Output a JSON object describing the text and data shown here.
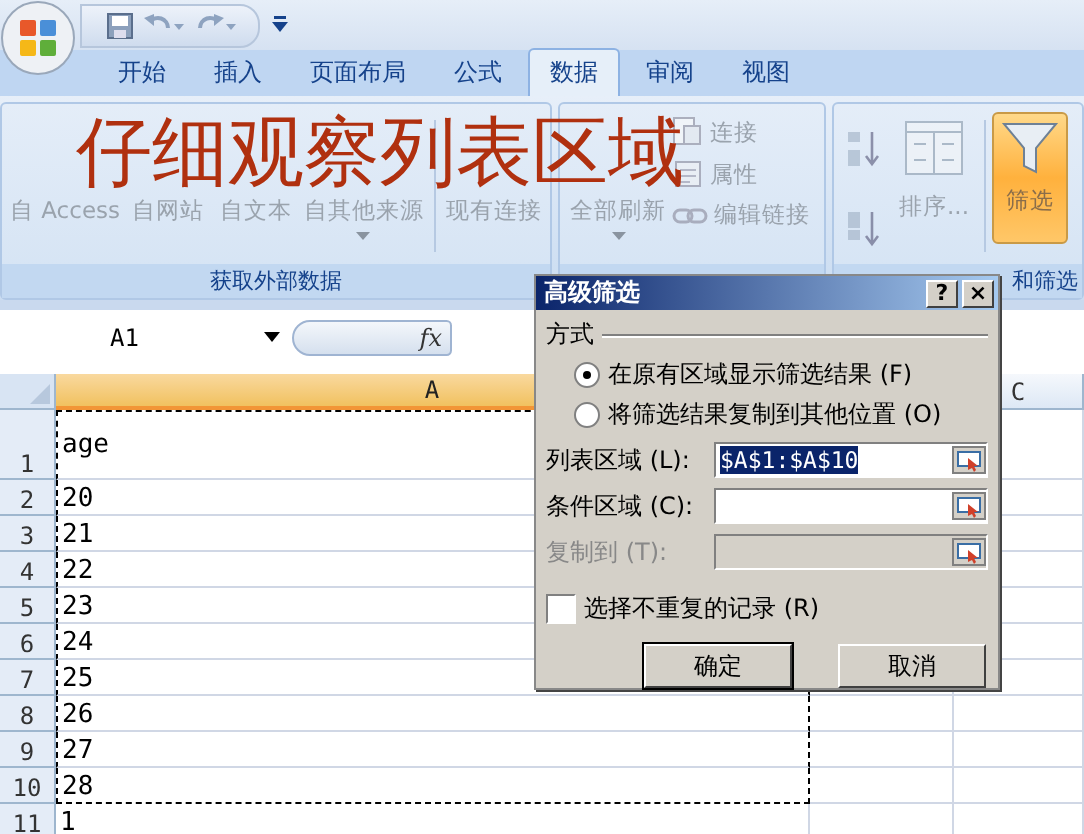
{
  "tabs": [
    {
      "label": "开始",
      "selected": false
    },
    {
      "label": "插入",
      "selected": false
    },
    {
      "label": "页面布局",
      "selected": false
    },
    {
      "label": "公式",
      "selected": false
    },
    {
      "label": "数据",
      "selected": true
    },
    {
      "label": "审阅",
      "selected": false
    },
    {
      "label": "视图",
      "selected": false
    }
  ],
  "ribbon": {
    "groups": [
      {
        "label": "获取外部数据",
        "buttons": [
          {
            "kind": "large",
            "label": "自 Access",
            "disabled": true,
            "pressed": false,
            "dropdown": false
          },
          {
            "kind": "large",
            "label": "自网站",
            "disabled": true,
            "pressed": false,
            "dropdown": false
          },
          {
            "kind": "large",
            "label": "自文本",
            "disabled": true,
            "pressed": false,
            "dropdown": false
          },
          {
            "kind": "large",
            "label": "自其他来源",
            "disabled": true,
            "pressed": false,
            "dropdown": true
          },
          {
            "kind": "large",
            "label": "现有连接",
            "disabled": true,
            "pressed": false,
            "dropdown": false
          }
        ]
      },
      {
        "buttons": [
          {
            "kind": "large",
            "label": "全部刷新",
            "disabled": true,
            "pressed": false,
            "dropdown": true
          },
          {
            "kind": "small",
            "label": "连接",
            "disabled": true,
            "pressed": false,
            "dropdown": false
          },
          {
            "kind": "small",
            "label": "属性",
            "disabled": true,
            "pressed": false,
            "dropdown": false
          },
          {
            "kind": "small",
            "label": "编辑链接",
            "disabled": true,
            "pressed": false,
            "dropdown": false
          }
        ]
      },
      {
        "label": "和筛选",
        "buttons": [
          {
            "kind": "sort",
            "disabled": true,
            "pressed": false,
            "dropdown": false
          },
          {
            "kind": "large",
            "label": "排序...",
            "disabled": true,
            "pressed": false,
            "dropdown": false
          },
          {
            "kind": "large",
            "label": "筛选",
            "disabled": true,
            "pressed": true,
            "dropdown": false
          }
        ]
      }
    ]
  },
  "annotation": "仔细观察列表区域",
  "name_box": "A1",
  "fx": "fx",
  "columns": [
    {
      "label": "A",
      "selected": true
    },
    {
      "label": "C",
      "selected": false
    }
  ],
  "rows": [
    {
      "number": "1",
      "value": "age",
      "in_range": true
    },
    {
      "number": "2",
      "value": "20",
      "in_range": true
    },
    {
      "number": "3",
      "value": "21",
      "in_range": true
    },
    {
      "number": "4",
      "value": "22",
      "in_range": true
    },
    {
      "number": "5",
      "value": "23",
      "in_range": true
    },
    {
      "number": "6",
      "value": "24",
      "in_range": true
    },
    {
      "number": "7",
      "value": "25",
      "in_range": true
    },
    {
      "number": "8",
      "value": "26",
      "in_range": true
    },
    {
      "number": "9",
      "value": "27",
      "in_range": true
    },
    {
      "number": "10",
      "value": "28",
      "in_range": true
    },
    {
      "number": "11",
      "value": "1",
      "in_range": false
    }
  ],
  "dialog": {
    "title": "高级筛选",
    "help": "?",
    "close": "×",
    "section": "方式",
    "options": [
      {
        "label": "在原有区域显示筛选结果 (F)",
        "selected": true
      },
      {
        "label": "将筛选结果复制到其他位置 (O)",
        "selected": false
      }
    ],
    "fields": [
      {
        "label": "列表区域 (L):",
        "value": "$A$1:$A$10",
        "disabled": false,
        "highlighted": true
      },
      {
        "label": "条件区域 (C):",
        "disabled": false
      },
      {
        "label": "复制到 (T):",
        "disabled": true
      }
    ],
    "checkbox": {
      "label": "选择不重复的记录 (R)",
      "checked": false
    },
    "buttons": [
      {
        "label": "确定",
        "default": true
      },
      {
        "label": "取消",
        "default": false
      }
    ]
  }
}
